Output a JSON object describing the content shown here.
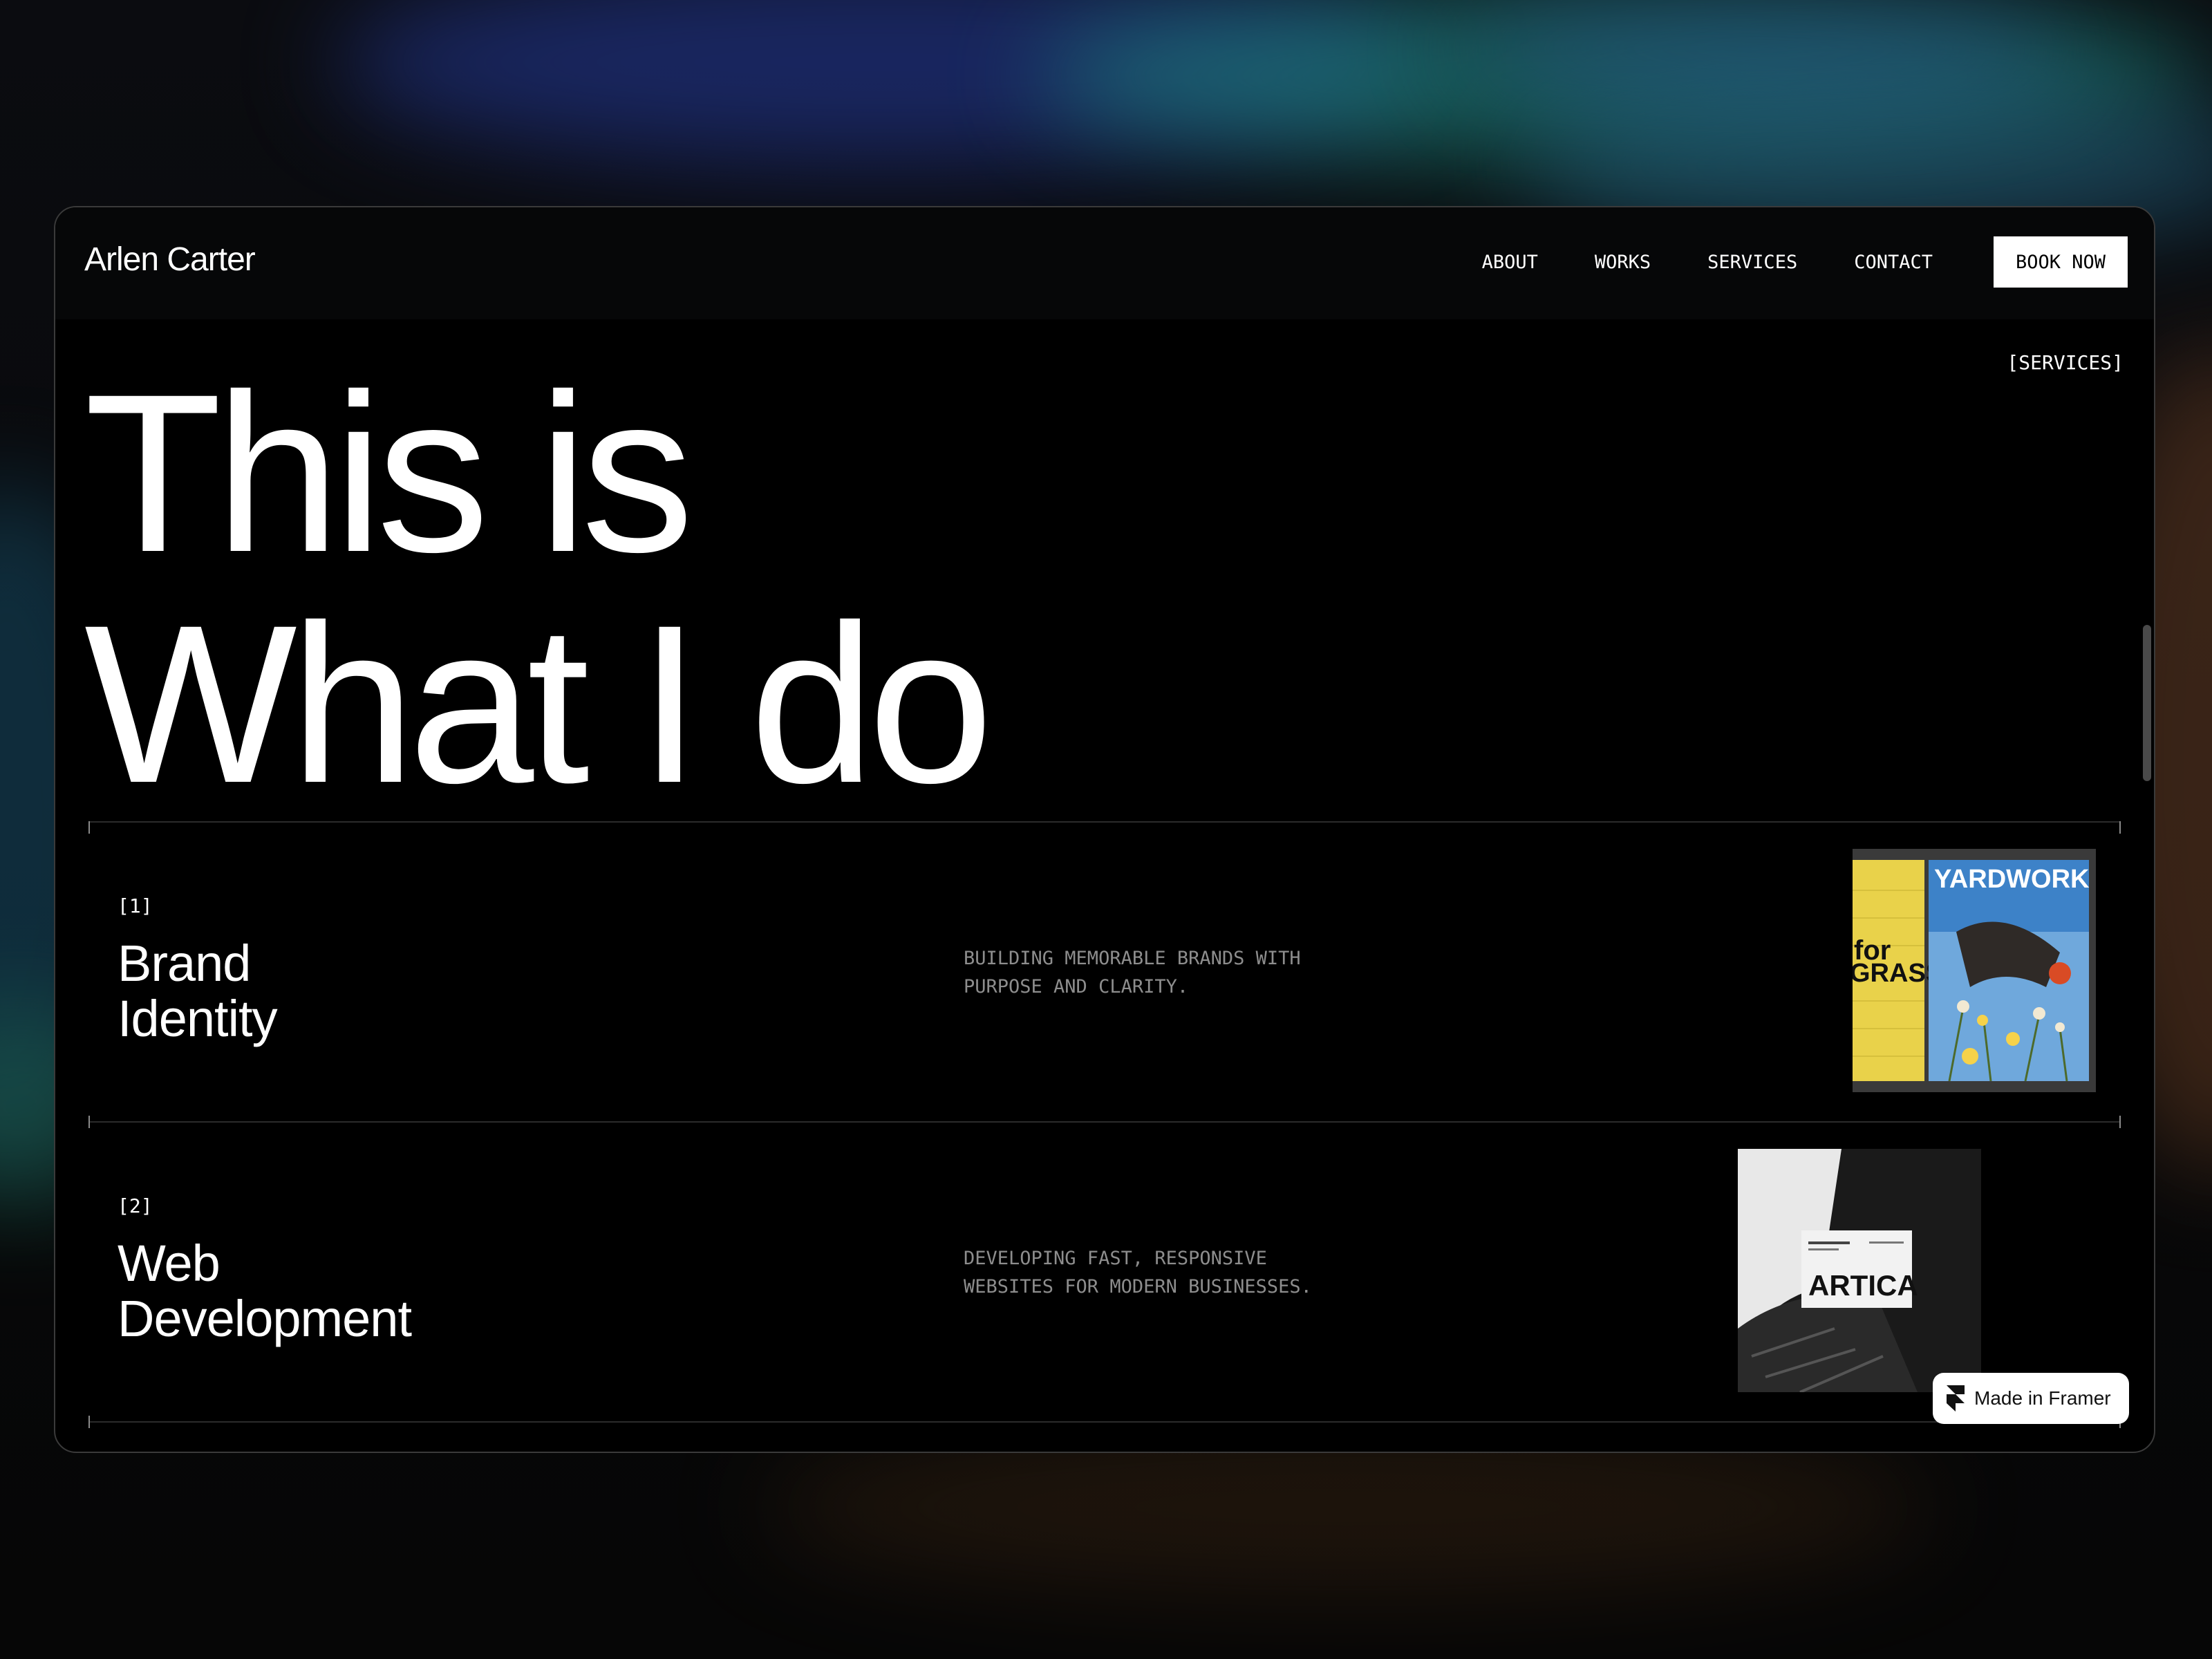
{
  "brand": "Arlen Carter",
  "nav": {
    "links": [
      "ABOUT",
      "WORKS",
      "SERVICES",
      "CONTACT"
    ],
    "cta": "BOOK NOW"
  },
  "section_tag": "[SERVICES]",
  "hero": {
    "line1": "This is",
    "line2": "What I do"
  },
  "services": [
    {
      "number": "[1]",
      "title_line1": "Brand",
      "title_line2": "Identity",
      "description": "BUILDING MEMORABLE BRANDS WITH PURPOSE AND CLARITY.",
      "image_texts": [
        "YARDWORK",
        "for",
        "GRASS"
      ]
    },
    {
      "number": "[2]",
      "title_line1": "Web",
      "title_line2": "Development",
      "description": "DEVELOPING FAST, RESPONSIVE WEBSITES FOR MODERN BUSINESSES.",
      "image_texts": [
        "ARTICA"
      ]
    }
  ],
  "framer_badge": "Made in Framer",
  "icons": {
    "framer": "framer-logo-icon"
  },
  "colors": {
    "background": "#000000",
    "text": "#ffffff",
    "muted_text": "#8d8d8d",
    "cta_bg": "#ffffff"
  }
}
